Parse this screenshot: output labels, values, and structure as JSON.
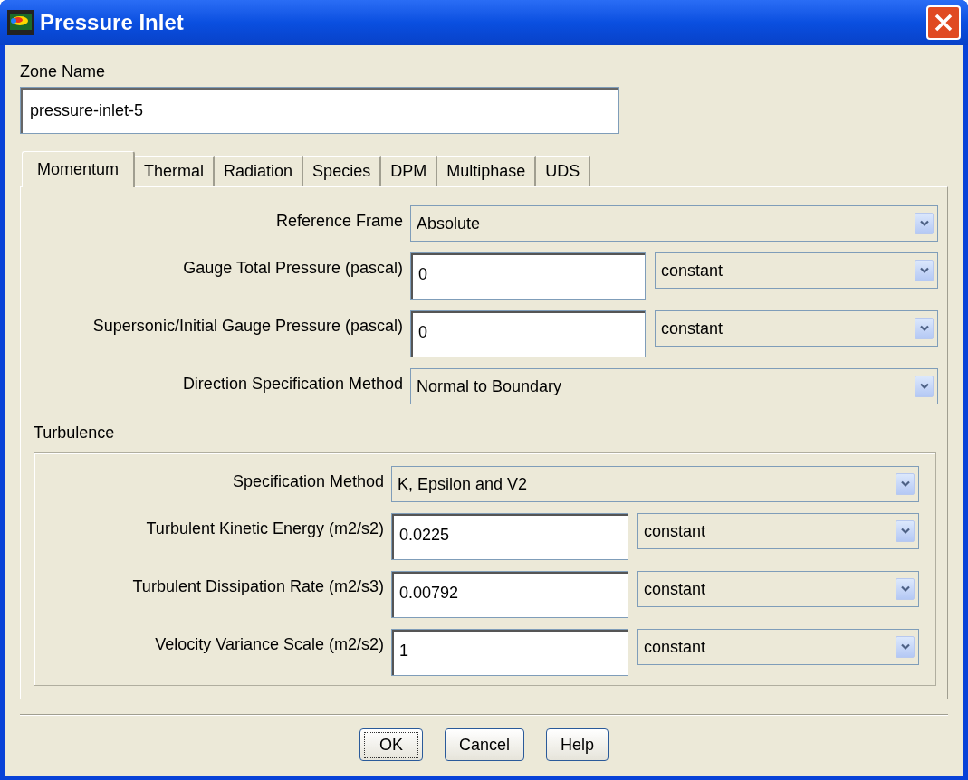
{
  "window": {
    "title": "Pressure Inlet"
  },
  "zone_name": {
    "label": "Zone Name",
    "value": "pressure-inlet-5"
  },
  "tabs": [
    {
      "label": "Momentum",
      "selected": true
    },
    {
      "label": "Thermal",
      "selected": false
    },
    {
      "label": "Radiation",
      "selected": false
    },
    {
      "label": "Species",
      "selected": false
    },
    {
      "label": "DPM",
      "selected": false
    },
    {
      "label": "Multiphase",
      "selected": false
    },
    {
      "label": "UDS",
      "selected": false
    }
  ],
  "fields": [
    {
      "kind": "select",
      "label": "Reference Frame",
      "value": "Absolute"
    },
    {
      "kind": "input_select",
      "label": "Gauge Total Pressure (pascal)",
      "value": "0",
      "method": "constant"
    },
    {
      "kind": "input_select",
      "label": "Supersonic/Initial Gauge Pressure (pascal)",
      "value": "0",
      "method": "constant"
    },
    {
      "kind": "select",
      "label": "Direction Specification Method",
      "value": "Normal to Boundary"
    }
  ],
  "turbulence": {
    "title": "Turbulence",
    "fields": [
      {
        "kind": "select",
        "label": "Specification Method",
        "value": "K, Epsilon and V2"
      },
      {
        "kind": "input_select",
        "label": "Turbulent Kinetic Energy (m2/s2)",
        "value": "0.0225",
        "method": "constant"
      },
      {
        "kind": "input_select",
        "label": "Turbulent Dissipation Rate (m2/s3)",
        "value": "0.00792",
        "method": "constant"
      },
      {
        "kind": "input_select",
        "label": "Velocity Variance Scale (m2/s2)",
        "value": "1",
        "method": "constant"
      }
    ]
  },
  "buttons": [
    {
      "label": "OK",
      "focused": true
    },
    {
      "label": "Cancel",
      "focused": false
    },
    {
      "label": "Help",
      "focused": false
    }
  ]
}
